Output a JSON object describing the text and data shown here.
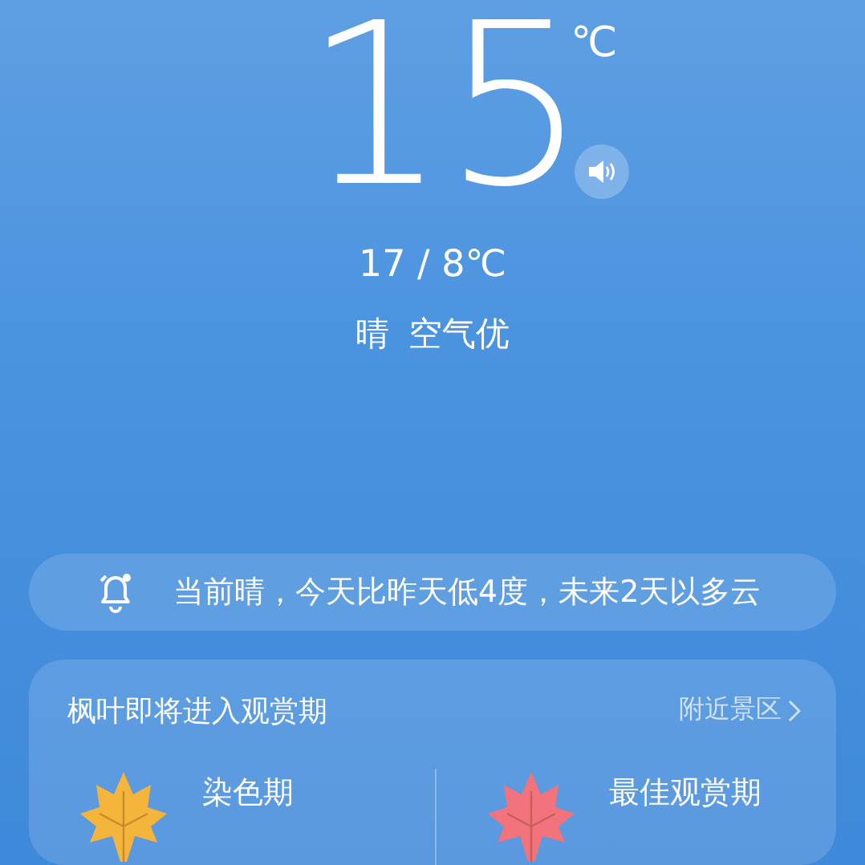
{
  "current": {
    "temperature": "15",
    "unit": "℃",
    "range": "17 / 8℃",
    "condition": "晴",
    "air_quality": "空气优"
  },
  "alert": {
    "text": "当前晴，今天比昨天低4度，未来2天以多云"
  },
  "foliage": {
    "title": "枫叶即将进入观赏期",
    "link": "附近景区",
    "stages": [
      {
        "label": "染色期",
        "color": "#f5b53a"
      },
      {
        "label": "最佳观赏期",
        "color": "#f2737c"
      }
    ]
  }
}
